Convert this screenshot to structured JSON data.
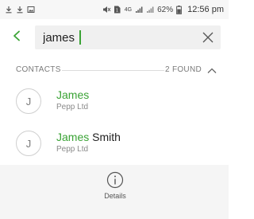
{
  "status_bar": {
    "battery": "62%",
    "time": "12:56 pm",
    "network_label": "4G"
  },
  "search": {
    "value": "james",
    "placeholder": ""
  },
  "section": {
    "title": "CONTACTS",
    "count": "2 FOUND"
  },
  "contacts": [
    {
      "initial": "J",
      "name_match": "James",
      "name_rest": "",
      "org": "Pepp Ltd"
    },
    {
      "initial": "J",
      "name_match": "James",
      "name_rest": " Smith",
      "org": "Pepp Ltd"
    }
  ],
  "bottom": {
    "details_label": "Details"
  },
  "colors": {
    "accent": "#3aa335",
    "muted": "#7a7a7a"
  }
}
